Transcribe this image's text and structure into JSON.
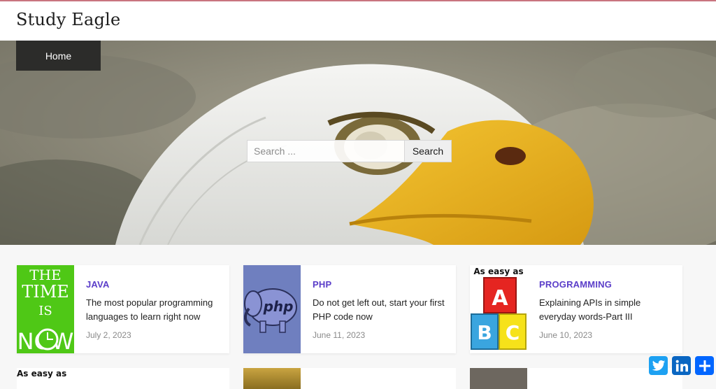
{
  "site": {
    "title": "Study Eagle"
  },
  "nav": {
    "home": "Home"
  },
  "search": {
    "placeholder": "Search ...",
    "button": "Search"
  },
  "posts": [
    {
      "category": "JAVA",
      "title": "The most popular programming languages to learn right now",
      "date": "July 2, 2023",
      "thumb_text": [
        "THE",
        "TIME",
        "IS",
        "NOW"
      ]
    },
    {
      "category": "PHP",
      "title": "Do not get left out, start your first PHP code now",
      "date": "June 11, 2023",
      "thumb_text": [
        "php"
      ]
    },
    {
      "category": "PROGRAMMING",
      "title": "Explaining APIs in simple everyday words-Part III",
      "date": "June 10, 2023",
      "thumb_text": [
        "As easy as",
        "A",
        "B",
        "C"
      ]
    }
  ],
  "next_row": {
    "thumb_text": "As easy as"
  },
  "colors": {
    "accent": "#5b3ec9",
    "twitter": "#1da1f2",
    "linkedin": "#0a66c2",
    "share": "#0166ff"
  },
  "icons": [
    "twitter-icon",
    "linkedin-icon",
    "share-plus-icon"
  ]
}
